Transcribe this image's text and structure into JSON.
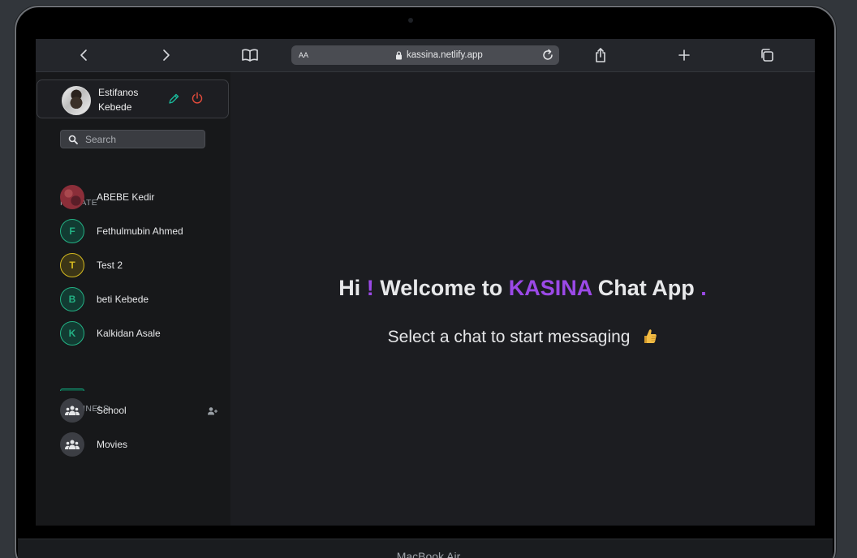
{
  "browser": {
    "url": "kassina.netlify.app",
    "reader_label": "AA"
  },
  "device": {
    "label": "MacBook Air"
  },
  "profile": {
    "name": "Estifanos Kebede"
  },
  "search": {
    "placeholder": "Search"
  },
  "sections": {
    "private": "PRIVATE",
    "channels": "CHANNELS"
  },
  "private_contacts": [
    {
      "name": "ABEBE Kedir",
      "initial": "",
      "has_photo": true
    },
    {
      "name": "Fethulmubin Ahmed",
      "initial": "F",
      "color": "#23b184"
    },
    {
      "name": "Test 2",
      "initial": "T",
      "color": "#d4b91f"
    },
    {
      "name": "beti Kebede",
      "initial": "B",
      "color": "#23b184"
    },
    {
      "name": "Kalkidan Asale",
      "initial": "K",
      "color": "#23b184"
    }
  ],
  "channels": [
    {
      "name": "School"
    },
    {
      "name": "Movies"
    }
  ],
  "welcome": {
    "hi": "Hi",
    "exclaim": "!",
    "welcome_to": "Welcome to",
    "brand": "KASINA",
    "chat_app": "Chat App",
    "dot": ".",
    "subtitle": "Select a chat to start messaging"
  },
  "colors": {
    "accent": "#9b49e7",
    "edit": "#1abc9c",
    "logout": "#e74c3c"
  }
}
